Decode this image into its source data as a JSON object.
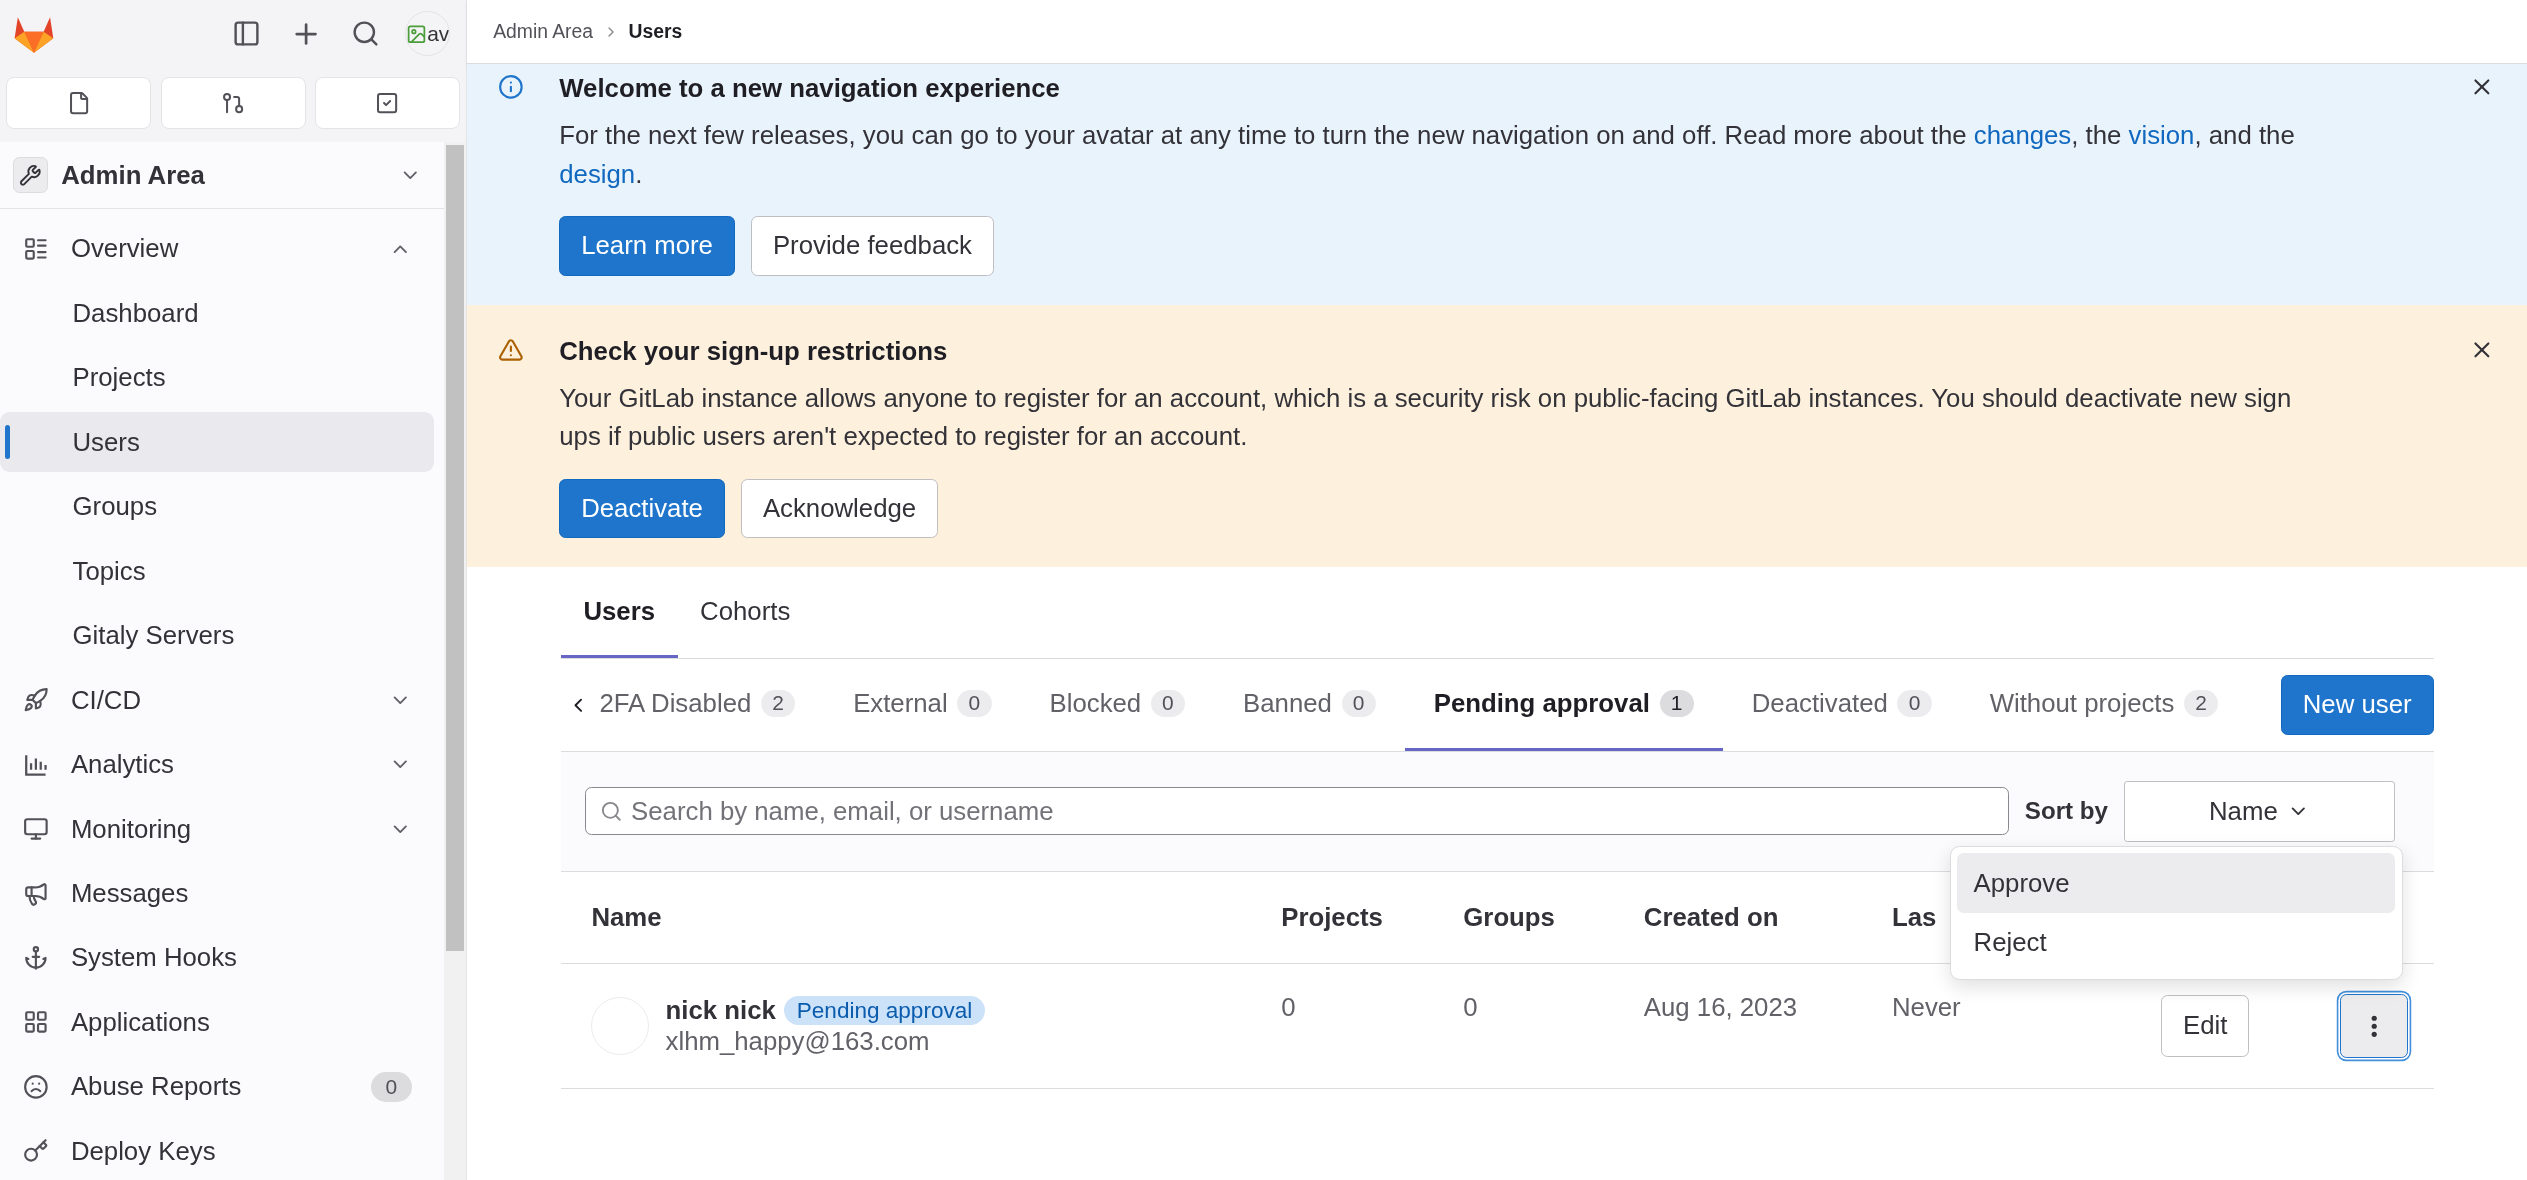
{
  "sidebar": {
    "avatar_alt": "av",
    "context": "Admin Area",
    "nav": [
      {
        "label": "Overview",
        "selected": false,
        "expanded": true,
        "children": [
          {
            "label": "Dashboard",
            "selected": false
          },
          {
            "label": "Projects",
            "selected": false
          },
          {
            "label": "Users",
            "selected": true
          },
          {
            "label": "Groups",
            "selected": false
          },
          {
            "label": "Topics",
            "selected": false
          },
          {
            "label": "Gitaly Servers",
            "selected": false
          }
        ]
      },
      {
        "label": "CI/CD",
        "selected": false,
        "expanded": false
      },
      {
        "label": "Analytics",
        "selected": false,
        "expanded": false
      },
      {
        "label": "Monitoring",
        "selected": false,
        "expanded": false
      },
      {
        "label": "Messages",
        "selected": false
      },
      {
        "label": "System Hooks",
        "selected": false
      },
      {
        "label": "Applications",
        "selected": false
      },
      {
        "label": "Abuse Reports",
        "selected": false,
        "badge": "0"
      },
      {
        "label": "Deploy Keys",
        "selected": false
      }
    ]
  },
  "breadcrumb": [
    "Admin Area",
    "Users"
  ],
  "banners": [
    {
      "kind": "info",
      "title": "Welcome to a new navigation experience",
      "body": [
        {
          "text": "For the next few releases, you can go to your avatar at any time to turn the new navigation on and off. Read more about the "
        },
        {
          "link": "changes"
        },
        {
          "text": ", the "
        },
        {
          "link": "vision"
        },
        {
          "text": ", and the "
        },
        {
          "link": "design"
        },
        {
          "text": "."
        }
      ],
      "buttons": [
        "Learn more",
        "Provide feedback"
      ]
    },
    {
      "kind": "warning",
      "title": "Check your sign-up restrictions",
      "body": [
        {
          "text": "Your GitLab instance allows anyone to register for an account, which is a security risk on public-facing GitLab instances. You should deactivate new sign ups if public users aren't expected to register for an account."
        }
      ],
      "buttons": [
        "Deactivate",
        "Acknowledge"
      ]
    }
  ],
  "tabs": [
    {
      "label": "Users",
      "selected": true
    },
    {
      "label": "Cohorts",
      "selected": false
    }
  ],
  "filter_tabs": [
    {
      "label": "2FA Disabled",
      "count": "2",
      "selected": false
    },
    {
      "label": "External",
      "count": "0",
      "selected": false
    },
    {
      "label": "Blocked",
      "count": "0",
      "selected": false
    },
    {
      "label": "Banned",
      "count": "0",
      "selected": false
    },
    {
      "label": "Pending approval",
      "count": "1",
      "selected": true
    },
    {
      "label": "Deactivated",
      "count": "0",
      "selected": false
    },
    {
      "label": "Without projects",
      "count": "2",
      "selected": false
    }
  ],
  "new_user_button": "New user",
  "search": {
    "placeholder": "Search by name, email, or username"
  },
  "sort": {
    "label": "Sort by",
    "value": "Name"
  },
  "table": {
    "columns": [
      "Name",
      "Projects",
      "Groups",
      "Created on",
      "Las"
    ],
    "rows": [
      {
        "name": "nick nick",
        "badge": "Pending approval",
        "email": "xlhm_happy@163.com",
        "projects": "0",
        "groups": "0",
        "created_on": "Aug 16, 2023",
        "last_activity": "Never",
        "edit": "Edit"
      }
    ]
  },
  "row_menu": [
    {
      "label": "Approve",
      "selected": true
    },
    {
      "label": "Reject",
      "selected": false
    }
  ]
}
